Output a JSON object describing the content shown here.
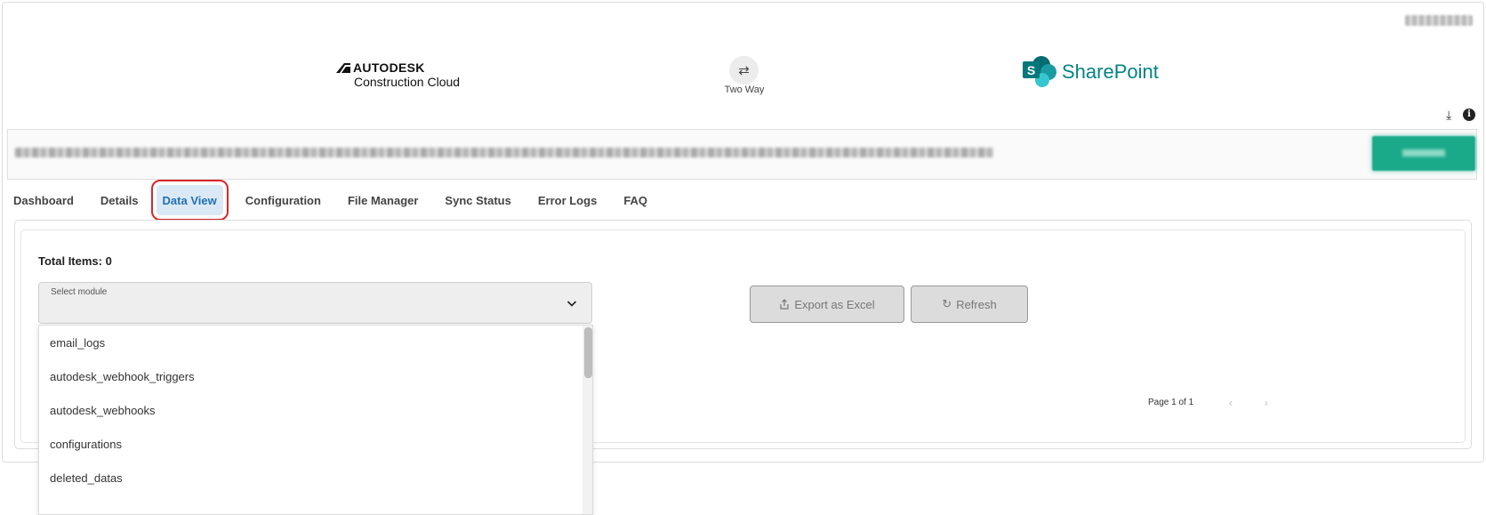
{
  "header": {
    "source_app": {
      "line1": "AUTODESK",
      "line2": "Construction Cloud"
    },
    "sync": {
      "icon": "swap-arrows-icon",
      "label": "Two Way"
    },
    "target_app": {
      "name": "SharePoint",
      "brand_color": "#038387"
    }
  },
  "banner": {
    "accent_color": "#1aaa8a"
  },
  "tabs": [
    {
      "label": "Dashboard"
    },
    {
      "label": "Details"
    },
    {
      "label": "Data View",
      "active": true
    },
    {
      "label": "Configuration"
    },
    {
      "label": "File Manager"
    },
    {
      "label": "Sync Status"
    },
    {
      "label": "Error Logs"
    },
    {
      "label": "FAQ"
    }
  ],
  "data_view": {
    "total_items_label": "Total Items: 0",
    "select": {
      "label": "Select module",
      "icon": "chevron-down-icon"
    },
    "export_button": {
      "label": "Export as Excel",
      "icon": "upload-icon"
    },
    "refresh_button": {
      "label": "Refresh",
      "icon": "refresh-icon"
    },
    "pagination": {
      "text": "Page 1 of 1"
    },
    "dropdown_options": [
      "email_logs",
      "autodesk_webhook_triggers",
      "autodesk_webhooks",
      "configurations",
      "deleted_datas"
    ]
  }
}
